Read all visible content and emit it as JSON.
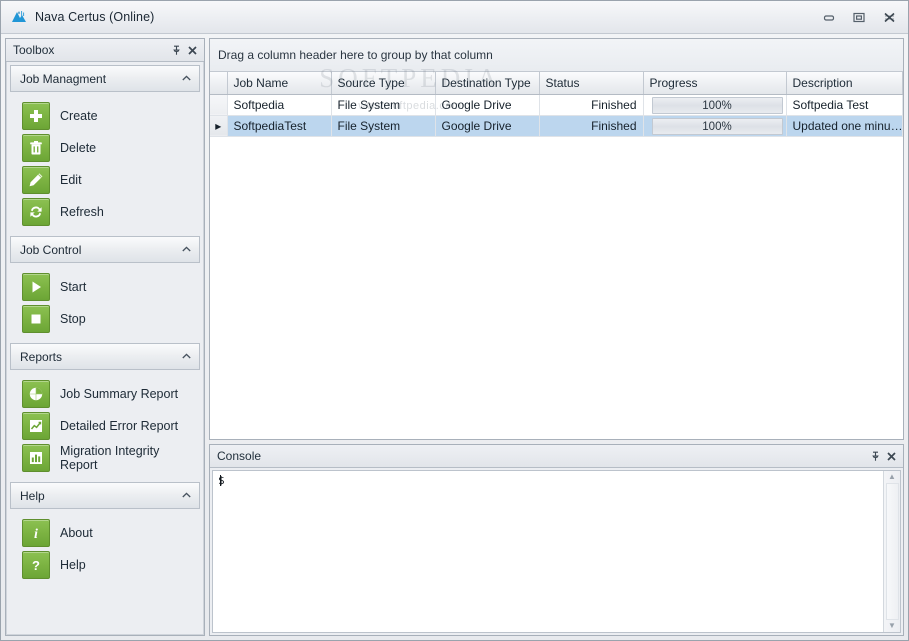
{
  "window": {
    "title": "Nava Certus (Online)",
    "app_icon": "nava-certus-logo",
    "minimize_label": "Minimize",
    "maximize_label": "Restore",
    "close_label": "Close"
  },
  "toolbox": {
    "caption": "Toolbox",
    "pin_label": "Auto Hide",
    "close_label": "Close",
    "groups": [
      {
        "title": "Job Managment",
        "collapse_icon": "chevron-up-icon",
        "items": [
          {
            "label": "Create",
            "icon": "plus-icon"
          },
          {
            "label": "Delete",
            "icon": "trash-icon"
          },
          {
            "label": "Edit",
            "icon": "pencil-icon"
          },
          {
            "label": "Refresh",
            "icon": "refresh-icon"
          }
        ]
      },
      {
        "title": "Job Control",
        "collapse_icon": "chevron-up-icon",
        "items": [
          {
            "label": "Start",
            "icon": "play-icon"
          },
          {
            "label": "Stop",
            "icon": "stop-icon"
          }
        ]
      },
      {
        "title": "Reports",
        "collapse_icon": "chevron-up-icon",
        "items": [
          {
            "label": "Job Summary Report",
            "icon": "pie-chart-icon"
          },
          {
            "label": "Detailed Error Report",
            "icon": "line-chart-icon"
          },
          {
            "label": "Migration Integrity Report",
            "icon": "bar-chart-icon"
          }
        ]
      },
      {
        "title": "Help",
        "collapse_icon": "chevron-up-icon",
        "items": [
          {
            "label": "About",
            "icon": "info-icon"
          },
          {
            "label": "Help",
            "icon": "question-icon"
          }
        ]
      }
    ]
  },
  "grid": {
    "group_hint": "Drag a column header here to group by that column",
    "columns": [
      "Job Name",
      "Source Type",
      "Destination Type",
      "Status",
      "Progress",
      "Description"
    ],
    "rows": [
      {
        "indicator": "",
        "job_name": "Softpedia",
        "source_type": "File System",
        "destination_type": "Google Drive",
        "status": "Finished",
        "progress": "100%",
        "progress_value": 100,
        "description": "Softpedia Test",
        "selected": false
      },
      {
        "indicator": "▸",
        "job_name": "SoftpediaTest",
        "source_type": "File System",
        "destination_type": "Google Drive",
        "status": "Finished",
        "progress": "100%",
        "progress_value": 100,
        "description": "Updated one minu…",
        "selected": true
      }
    ],
    "watermark": "SOFTPEDIA",
    "watermark_sub": "www.softpedia.com"
  },
  "console": {
    "caption": "Console",
    "pin_label": "Auto Hide",
    "close_label": "Close",
    "prompt": "$"
  }
}
